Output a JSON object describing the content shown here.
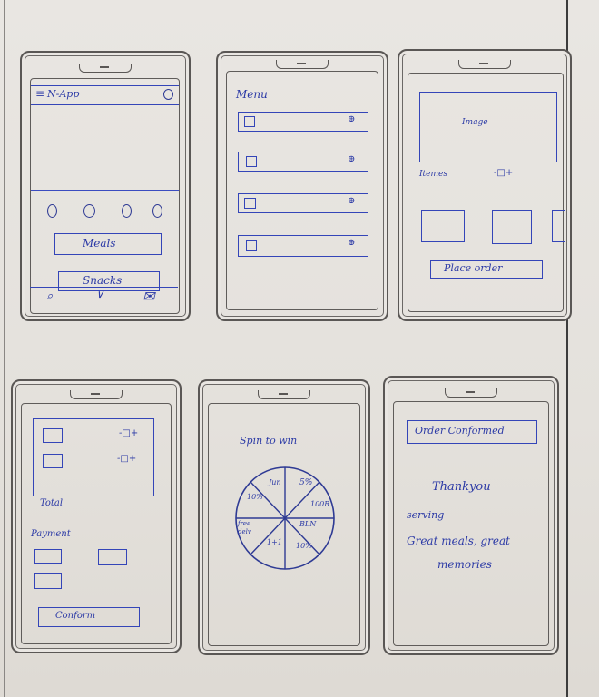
{
  "sketch": {
    "screen1": {
      "header_title": "N-App",
      "buttons": [
        "Meals",
        "Snacks"
      ]
    },
    "screen2": {
      "title": "Menu"
    },
    "screen3": {
      "image_label": "Image",
      "item_label": "Itemes",
      "qty_control": "-□+",
      "button": "Place order"
    },
    "screen4": {
      "qty_control": "-□+",
      "total_label": "Total",
      "payment_label": "Payment",
      "button": "Conform"
    },
    "screen5": {
      "title": "Spin to win",
      "wheel_segments": [
        "Jun",
        "5%",
        "100R",
        "BLN",
        "10%",
        "1+1",
        "free delv",
        "10%"
      ]
    },
    "screen6": {
      "banner": "Order Conformed",
      "thanks": "Thankyou",
      "serving": "serving",
      "slogan_line1": "Great meals, great",
      "slogan_line2": "memories"
    }
  }
}
